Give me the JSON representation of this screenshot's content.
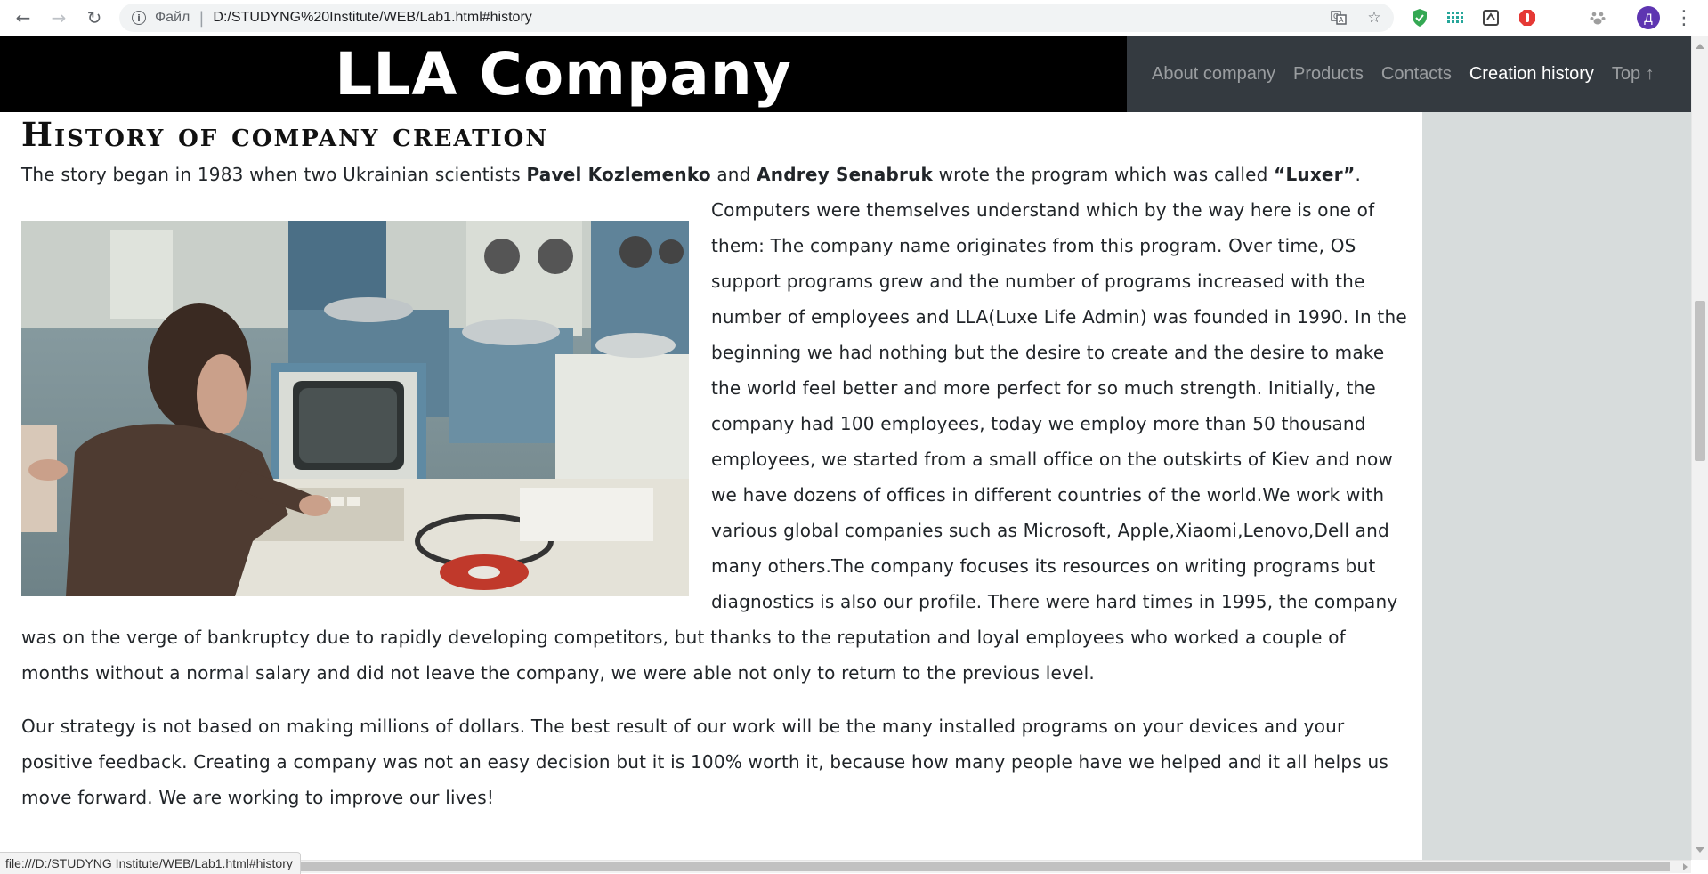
{
  "browser": {
    "scheme_label": "Файл",
    "url": "D:/STUDYNG%20Institute/WEB/Lab1.html#history",
    "profile_initial": "Д"
  },
  "site": {
    "brand": "LLA Company",
    "nav": [
      {
        "label": "About company",
        "active": false
      },
      {
        "label": "Products",
        "active": false
      },
      {
        "label": "Contacts",
        "active": false
      },
      {
        "label": "Creation history",
        "active": true
      },
      {
        "label": "Top ↑",
        "active": false
      }
    ]
  },
  "history": {
    "heading": "History of company creation",
    "p1_intro": "The story began in 1983 when two Ukrainian scientists ",
    "person1": "Pavel Kozlemenko",
    "and_word": " and ",
    "person2": "Andrey Senabruk",
    "p1_mid": " wrote the program which was called ",
    "program_name": "“Luxer”",
    "p1_rest": ". Computers were themselves understand which by the way here is one of them: The company name originates from this program. Over time, OS support programs grew and the number of programs increased with the number of employees and LLA(Luxe Life Admin) was founded in 1990. In the beginning we had nothing but the desire to create and the desire to make the world feel better and more perfect for so much strength. Initially, the company had 100 employees, today we employ more than 50 thousand employees, we started from a small office on the outskirts of Kiev and now we have dozens of offices in different countries of the world.We work with various global companies such as Microsoft, Apple,Xiaomi,Lenovo,Dell and many others.The company focuses its resources on writing programs but diagnostics is also our profile. There were hard times in 1995, the company was on the verge of bankruptcy due to rapidly developing competitors, but thanks to the reputation and loyal employees who worked a couple of months without a normal salary and did not leave the company, we were able not only to return to the previous level.",
    "p2": "Our strategy is not based on making millions of dollars. The best result of our work will be the many installed programs on your devices and your positive feedback. Creating a company was not an easy decision but it is 100% worth it, because how many people have we helped and it all helps us move forward. We are working to improve our lives!"
  },
  "status_bar": "file:///D:/STUDYNG Institute/WEB/Lab1.html#history",
  "colors": {
    "brand_bg": "#000000",
    "navbar_bg": "#343a40",
    "sidebar_bg": "#d7dcdc"
  }
}
